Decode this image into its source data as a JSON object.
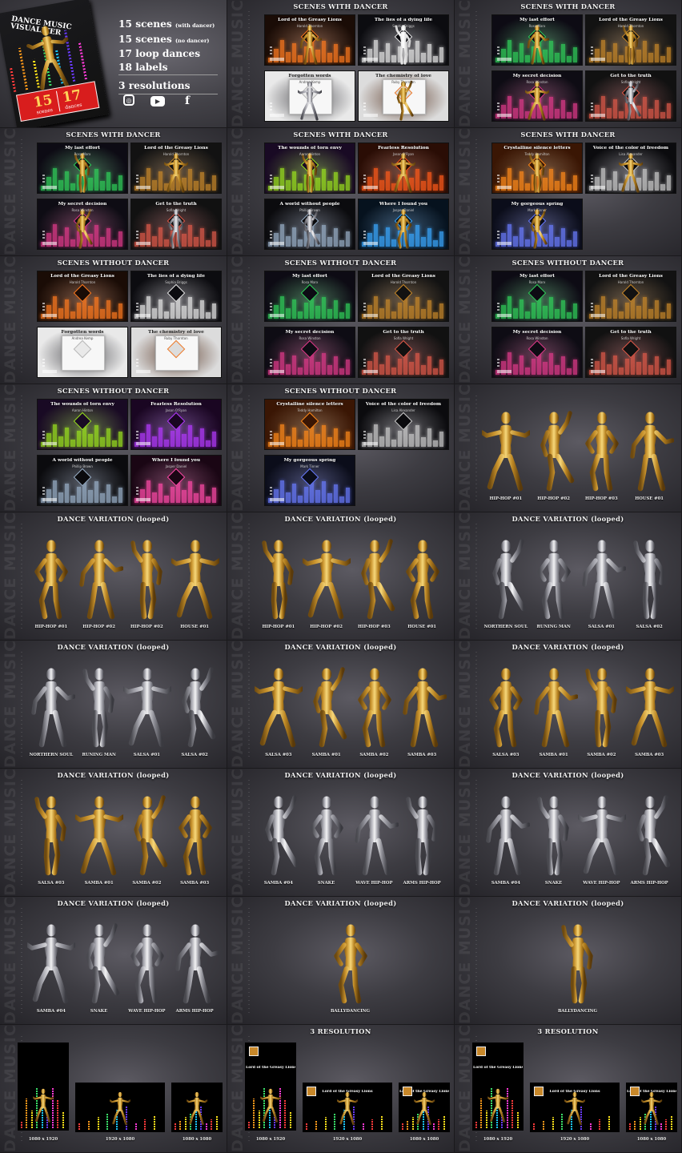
{
  "watermark": "DANCE MUSIC VISUALIZER",
  "cover": {
    "title": "DANCE MUSIC VISUALIZER",
    "badge_scenes_num": "15",
    "badge_scenes_word": "scenes",
    "badge_dances_num": "17",
    "badge_dances_word": "dances"
  },
  "stats": [
    {
      "main": "15 scenes",
      "note": "(with dancer)"
    },
    {
      "main": "15 scenes",
      "note": "(no dancer)"
    },
    {
      "main": "17 loop dances",
      "note": ""
    },
    {
      "main": "18 labels",
      "note": ""
    },
    {
      "main": "3 resolutions",
      "note": ""
    }
  ],
  "social_icons": [
    "instagram-icon",
    "youtube-icon",
    "facebook-icon"
  ],
  "titles": {
    "with_dancer": "SCENES WITH DANCER",
    "without_dancer": "SCENES WITHOUT DANCER",
    "dance_variation": "DANCE VARIATION (looped)",
    "resolution": "3 RESOLUTION"
  },
  "scene_panels": [
    {
      "title_key": "with_dancer",
      "scenes": [
        {
          "t": "Lord of the Greasy Lions",
          "a": "Harold Thornton",
          "bg": "#1a0c06",
          "accent": "#ff7a1f",
          "dancer": "gold"
        },
        {
          "t": "The lies of a dying life",
          "a": "Sophia Briggs",
          "bg": "#0c0c10",
          "accent": "#e8e8e8",
          "dancer": "white"
        },
        {
          "t": "Forgotten words",
          "a": "Andrea Kemp",
          "bg": "#e9e9e9",
          "accent": "#b9b9b9",
          "dancer": "silver",
          "dark": true
        },
        {
          "t": "The chemistry of love",
          "a": "Ruby Thornton",
          "bg": "#dcdcdc",
          "accent": "#f07c2c",
          "dancer": "gold",
          "dark": true
        }
      ]
    },
    {
      "title_key": "with_dancer",
      "scenes": [
        {
          "t": "My last effort",
          "a": "Rosa Marx",
          "bg": "#0d0b14",
          "accent": "#30d05a",
          "dancer": "gold"
        },
        {
          "t": "Lord of the Greasy Lions",
          "a": "Harold Thornton",
          "bg": "#121212",
          "accent": "#c8882a",
          "dancer": "gold"
        },
        {
          "t": "My secret decision",
          "a": "Rosa Winston",
          "bg": "#0e0c14",
          "accent": "#e03a8a",
          "dancer": "gold"
        },
        {
          "t": "Get to the truth",
          "a": "Sofia Wright",
          "bg": "#111",
          "accent": "#e05a4a",
          "dancer": "silver"
        }
      ]
    }
  ],
  "rows": [
    [
      {
        "type": "cover"
      },
      {
        "type": "scenes",
        "title_key": "with_dancer",
        "scenes": [
          {
            "t": "Lord of the Greasy Lions",
            "a": "Harold Thornton",
            "bg": "#1a0c06",
            "accent": "#ff7a1f",
            "dancer": "gold"
          },
          {
            "t": "The lies of a dying life",
            "a": "Sophia Briggs",
            "bg": "#0c0c10",
            "accent": "#e8e8e8",
            "dancer": "white"
          },
          {
            "t": "Forgotten words",
            "a": "Andrea Kemp",
            "bg": "#e9e9e9",
            "accent": "#b9b9b9",
            "dancer": "silver",
            "dark": true
          },
          {
            "t": "The chemistry of love",
            "a": "Ruby Thornton",
            "bg": "#dcdcdc",
            "accent": "#f07c2c",
            "dancer": "gold",
            "dark": true
          }
        ]
      },
      {
        "type": "scenes",
        "title_key": "with_dancer",
        "scenes": [
          {
            "t": "My last effort",
            "a": "Rosa Marx",
            "bg": "#0d0b14",
            "accent": "#30d05a",
            "dancer": "gold"
          },
          {
            "t": "Lord of the Greasy Lions",
            "a": "Harold Thornton",
            "bg": "#121212",
            "accent": "#c8882a",
            "dancer": "gold"
          },
          {
            "t": "My secret decision",
            "a": "Rosa Winston",
            "bg": "#0e0c14",
            "accent": "#e03a8a",
            "dancer": "gold"
          },
          {
            "t": "Get to the truth",
            "a": "Sofia Wright",
            "bg": "#111",
            "accent": "#e05a4a",
            "dancer": "silver"
          }
        ]
      }
    ],
    [
      {
        "type": "scenes",
        "title_key": "with_dancer",
        "scenes": [
          {
            "t": "My last effort",
            "a": "Rosa Marx",
            "bg": "#0d0b14",
            "accent": "#30d05a",
            "dancer": "gold"
          },
          {
            "t": "Lord of the Greasy Lions",
            "a": "Harold Thornton",
            "bg": "#121212",
            "accent": "#c8882a",
            "dancer": "gold"
          },
          {
            "t": "My secret decision",
            "a": "Rosa Winston",
            "bg": "#0e0c14",
            "accent": "#e03a8a",
            "dancer": "gold"
          },
          {
            "t": "Get to the truth",
            "a": "Sofia Wright",
            "bg": "#111",
            "accent": "#e05a4a",
            "dancer": "silver"
          }
        ]
      },
      {
        "type": "scenes",
        "title_key": "with_dancer",
        "scenes": [
          {
            "t": "The wounds of torn envy",
            "a": "Aaron Hinton",
            "bg": "#190a24",
            "accent": "#9ae21e",
            "dancer": "gold"
          },
          {
            "t": "Fearless Resolution",
            "a": "Jason O'Ryan",
            "bg": "#2a0d05",
            "accent": "#ff5a1a",
            "dancer": "gold"
          },
          {
            "t": "A world without people",
            "a": "Phillip Brown",
            "bg": "#0b0b0e",
            "accent": "#9ab0c8",
            "dancer": "silver"
          },
          {
            "t": "Where I found you",
            "a": "Jasper Daniel",
            "bg": "#06121e",
            "accent": "#3aa8ff",
            "dancer": "gold"
          }
        ]
      },
      {
        "type": "scenes",
        "title_key": "with_dancer",
        "scenes": [
          {
            "t": "Crystalline silence letters",
            "a": "Teddy Hamilton",
            "bg": "#3a1604",
            "accent": "#ff8a1a",
            "dancer": "gold"
          },
          {
            "t": "Voice of the color of freedom",
            "a": "Lisa Alexander",
            "bg": "#0b0b0e",
            "accent": "#cccccc",
            "dancer": "gold"
          },
          {
            "t": "My gorgeous spring",
            "a": "Mark Tinner",
            "bg": "#0b0d1a",
            "accent": "#6a7cff",
            "dancer": "gold"
          }
        ]
      }
    ],
    [
      {
        "type": "scenes",
        "title_key": "without_dancer",
        "scenes": [
          {
            "t": "Lord of the Greasy Lions",
            "a": "Harold Thornton",
            "bg": "#1a0c06",
            "accent": "#ff7a1f"
          },
          {
            "t": "The lies of a dying life",
            "a": "Sophia Briggs",
            "bg": "#0c0c10",
            "accent": "#e8e8e8"
          },
          {
            "t": "Forgotten words",
            "a": "Andrea Kemp",
            "bg": "#e9e9e9",
            "accent": "#b9b9b9",
            "dark": true
          },
          {
            "t": "The chemistry of love",
            "a": "Ruby Thornton",
            "bg": "#dcdcdc",
            "accent": "#f07c2c",
            "dark": true
          }
        ]
      },
      {
        "type": "scenes",
        "title_key": "without_dancer",
        "scenes": [
          {
            "t": "My last effort",
            "a": "Rosa Marx",
            "bg": "#0d0b14",
            "accent": "#30d05a"
          },
          {
            "t": "Lord of the Greasy Lions",
            "a": "Harold Thornton",
            "bg": "#121212",
            "accent": "#c8882a"
          },
          {
            "t": "My secret decision",
            "a": "Rosa Winston",
            "bg": "#0e0c14",
            "accent": "#e03a8a"
          },
          {
            "t": "Get to the truth",
            "a": "Sofia Wright",
            "bg": "#111",
            "accent": "#e05a4a"
          }
        ]
      },
      {
        "type": "scenes",
        "title_key": "without_dancer",
        "scenes": [
          {
            "t": "My last effort",
            "a": "Rosa Marx",
            "bg": "#0d0b14",
            "accent": "#30d05a"
          },
          {
            "t": "Lord of the Greasy Lions",
            "a": "Harold Thornton",
            "bg": "#121212",
            "accent": "#c8882a"
          },
          {
            "t": "My secret decision",
            "a": "Rosa Winston",
            "bg": "#0e0c14",
            "accent": "#e03a8a"
          },
          {
            "t": "Get to the truth",
            "a": "Sofia Wright",
            "bg": "#111",
            "accent": "#e05a4a"
          }
        ]
      }
    ],
    [
      {
        "type": "scenes",
        "title_key": "without_dancer",
        "scenes": [
          {
            "t": "The wounds of torn envy",
            "a": "Aaron Hinton",
            "bg": "#190a24",
            "accent": "#9ae21e"
          },
          {
            "t": "Fearless Resolution",
            "a": "Jason O'Ryan",
            "bg": "#1a0622",
            "accent": "#b43aff"
          },
          {
            "t": "A world without people",
            "a": "Phillip Brown",
            "bg": "#0b0b0e",
            "accent": "#9ab0c8"
          },
          {
            "t": "Where I found you",
            "a": "Jasper Daniel",
            "bg": "#1a0614",
            "accent": "#ff4aa8"
          }
        ]
      },
      {
        "type": "scenes",
        "title_key": "without_dancer",
        "scenes": [
          {
            "t": "Crystalline silence letters",
            "a": "Teddy Hamilton",
            "bg": "#3a1604",
            "accent": "#ff8a1a"
          },
          {
            "t": "Voice of the color of freedom",
            "a": "Lisa Alexander",
            "bg": "#0b0b0e",
            "accent": "#cccccc"
          },
          {
            "t": "My gorgeous spring",
            "a": "Mark Tinner",
            "bg": "#0b0d1a",
            "accent": "#6a7cff"
          }
        ]
      },
      {
        "type": "dance",
        "title_key": "",
        "color": "gold",
        "labels": [
          "HIP-HOP #01",
          "HIP-HOP #02",
          "HIP-HOP #03",
          "HOUSE #01"
        ]
      }
    ],
    [
      {
        "type": "dance",
        "title_key": "dance_variation",
        "color": "gold",
        "labels": [
          "HIP-HOP #01",
          "HIP-HOP #02",
          "HIP-HOP #02",
          "HOUSE #01"
        ]
      },
      {
        "type": "dance",
        "title_key": "dance_variation",
        "color": "gold",
        "labels": [
          "HIP-HOP #01",
          "HIP-HOP #02",
          "HIP-HOP #03",
          "HOUSE #01"
        ]
      },
      {
        "type": "dance",
        "title_key": "dance_variation",
        "color": "silver",
        "labels": [
          "NORTHERN SOUL",
          "RUNING MAN",
          "SALSA #01",
          "SALSA #02"
        ]
      }
    ],
    [
      {
        "type": "dance",
        "title_key": "dance_variation",
        "color": "silver",
        "labels": [
          "NORTHERN SOUL",
          "RUNING MAN",
          "SALSA #01",
          "SALSA #02"
        ]
      },
      {
        "type": "dance",
        "title_key": "dance_variation",
        "color": "gold",
        "labels": [
          "SALSA #03",
          "SAMBA #01",
          "SAMBA #02",
          "SAMBA #03"
        ]
      },
      {
        "type": "dance",
        "title_key": "dance_variation",
        "color": "gold",
        "labels": [
          "SALSA #03",
          "SAMBA #01",
          "SAMBA #02",
          "SAMBA #03"
        ]
      }
    ],
    [
      {
        "type": "dance",
        "title_key": "dance_variation",
        "color": "gold",
        "labels": [
          "SALSA #03",
          "SAMBA #01",
          "SAMBA #02",
          "SAMBA #03"
        ]
      },
      {
        "type": "dance",
        "title_key": "dance_variation",
        "color": "silver",
        "labels": [
          "SAMBA #04",
          "SNAKE",
          "WAVE HIP-HOP",
          "ARMS HIP-HOP"
        ]
      },
      {
        "type": "dance",
        "title_key": "dance_variation",
        "color": "silver",
        "labels": [
          "SAMBA #04",
          "SNAKE",
          "WAVE HIP-HOP",
          "ARMS HIP-HOP"
        ]
      }
    ],
    [
      {
        "type": "dance",
        "title_key": "dance_variation",
        "color": "silver",
        "labels": [
          "SAMBA #04",
          "SNAKE",
          "WAVE HIP-HOP",
          "ARMS HIP-HOP"
        ]
      },
      {
        "type": "dance",
        "title_key": "dance_variation",
        "color": "gold",
        "labels": [
          "BALLYDANCING"
        ]
      },
      {
        "type": "dance",
        "title_key": "dance_variation",
        "color": "gold",
        "labels": [
          "BALLYDANCING"
        ]
      }
    ],
    [
      {
        "type": "res",
        "title_key": "",
        "song": "Lord of the Greasy Lions",
        "labels": [
          "1080 x 1920",
          "1920 x 1080",
          "1080 x 1080"
        ],
        "text": false
      },
      {
        "type": "res",
        "title_key": "resolution",
        "song": "Lord of the Greasy Lions",
        "labels": [
          "1080 x 1920",
          "1920 x 1080",
          "1080 x 1080"
        ],
        "text": true
      },
      {
        "type": "res",
        "title_key": "resolution",
        "song": "Lord of the Greasy Lions",
        "labels": [
          "1080 x 1920",
          "1920 x 1080",
          "1080 x 1080"
        ],
        "text": true
      }
    ]
  ]
}
